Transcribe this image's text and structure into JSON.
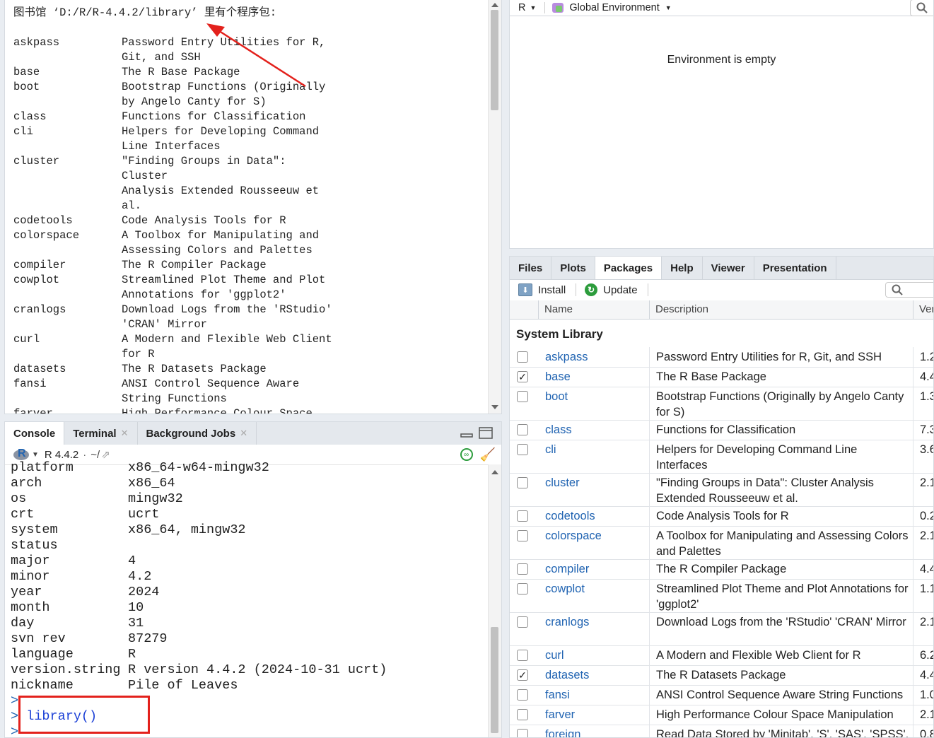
{
  "viewer": {
    "header": "图书馆 ‘D:/R/R-4.4.2/library’ 里有个程序包:",
    "libs": [
      {
        "name": "askpass",
        "desc": "Password Entry Utilities for R,\nGit, and SSH"
      },
      {
        "name": "base",
        "desc": "The R Base Package"
      },
      {
        "name": "boot",
        "desc": "Bootstrap Functions (Originally\nby Angelo Canty for S)"
      },
      {
        "name": "class",
        "desc": "Functions for Classification"
      },
      {
        "name": "cli",
        "desc": "Helpers for Developing Command\nLine Interfaces"
      },
      {
        "name": "cluster",
        "desc": "\"Finding Groups in Data\": Cluster\nAnalysis Extended Rousseeuw et\nal."
      },
      {
        "name": "codetools",
        "desc": "Code Analysis Tools for R"
      },
      {
        "name": "colorspace",
        "desc": "A Toolbox for Manipulating and\nAssessing Colors and Palettes"
      },
      {
        "name": "compiler",
        "desc": "The R Compiler Package"
      },
      {
        "name": "cowplot",
        "desc": "Streamlined Plot Theme and Plot\nAnnotations for 'ggplot2'"
      },
      {
        "name": "cranlogs",
        "desc": "Download Logs from the 'RStudio'\n'CRAN' Mirror"
      },
      {
        "name": "curl",
        "desc": "A Modern and Flexible Web Client\nfor R"
      },
      {
        "name": "datasets",
        "desc": "The R Datasets Package"
      },
      {
        "name": "fansi",
        "desc": "ANSI Control Sequence Aware\nString Functions"
      },
      {
        "name": "farver",
        "desc": "High Performance Colour Space\nManipulation"
      }
    ]
  },
  "console": {
    "tabs": [
      "Console",
      "Terminal",
      "Background Jobs"
    ],
    "version_label": "R 4.4.2",
    "path_label": "~/",
    "rows": [
      {
        "k": "platform",
        "v": "x86_64-w64-mingw32"
      },
      {
        "k": "arch",
        "v": "x86_64"
      },
      {
        "k": "os",
        "v": "mingw32"
      },
      {
        "k": "crt",
        "v": "ucrt"
      },
      {
        "k": "system",
        "v": "x86_64, mingw32"
      },
      {
        "k": "status",
        "v": ""
      },
      {
        "k": "major",
        "v": "4"
      },
      {
        "k": "minor",
        "v": "4.2"
      },
      {
        "k": "year",
        "v": "2024"
      },
      {
        "k": "month",
        "v": "10"
      },
      {
        "k": "day",
        "v": "31"
      },
      {
        "k": "svn rev",
        "v": "87279"
      },
      {
        "k": "language",
        "v": "R"
      },
      {
        "k": "version.string",
        "v": "R version 4.4.2 (2024-10-31 ucrt)"
      },
      {
        "k": "nickname",
        "v": "Pile of Leaves"
      }
    ],
    "prompt": ">",
    "command": "library()"
  },
  "env": {
    "lang": "R",
    "scope": "Global Environment",
    "empty_text": "Environment is empty"
  },
  "packages": {
    "tabs": [
      "Files",
      "Plots",
      "Packages",
      "Help",
      "Viewer",
      "Presentation"
    ],
    "install_label": "Install",
    "update_label": "Update",
    "col_name": "Name",
    "col_desc": "Description",
    "col_ver": "Ver",
    "section": "System Library",
    "rows": [
      {
        "name": "askpass",
        "desc": "Password Entry Utilities for R, Git, and SSH",
        "ver": "1.2",
        "checked": false
      },
      {
        "name": "base",
        "desc": "The R Base Package",
        "ver": "4.4",
        "checked": true
      },
      {
        "name": "boot",
        "desc": "Bootstrap Functions (Originally by Angelo Canty for S)",
        "ver": "1.3",
        "checked": false
      },
      {
        "name": "class",
        "desc": "Functions for Classification",
        "ver": "7.3",
        "checked": false
      },
      {
        "name": "cli",
        "desc": "Helpers for Developing Command Line Interfaces",
        "ver": "3.6",
        "checked": false
      },
      {
        "name": "cluster",
        "desc": "\"Finding Groups in Data\": Cluster Analysis Extended Rousseeuw et al.",
        "ver": "2.1",
        "checked": false
      },
      {
        "name": "codetools",
        "desc": "Code Analysis Tools for R",
        "ver": "0.2",
        "checked": false
      },
      {
        "name": "colorspace",
        "desc": "A Toolbox for Manipulating and Assessing Colors and Palettes",
        "ver": "2.1",
        "checked": false
      },
      {
        "name": "compiler",
        "desc": "The R Compiler Package",
        "ver": "4.4",
        "checked": false
      },
      {
        "name": "cowplot",
        "desc": "Streamlined Plot Theme and Plot Annotations for 'ggplot2'",
        "ver": "1.1",
        "checked": false
      },
      {
        "name": "cranlogs",
        "desc": "Download Logs from the 'RStudio' 'CRAN' Mirror",
        "ver": "2.1",
        "checked": false
      },
      {
        "name": "curl",
        "desc": "A Modern and Flexible Web Client for R",
        "ver": "6.2",
        "checked": false
      },
      {
        "name": "datasets",
        "desc": "The R Datasets Package",
        "ver": "4.4",
        "checked": true
      },
      {
        "name": "fansi",
        "desc": "ANSI Control Sequence Aware String Functions",
        "ver": "1.0",
        "checked": false
      },
      {
        "name": "farver",
        "desc": "High Performance Colour Space Manipulation",
        "ver": "2.1",
        "checked": false
      },
      {
        "name": "foreign",
        "desc": "Read Data Stored by 'Minitab', 'S', 'SAS', 'SPSS', 'Stata', 'Systat', 'Weka', 'dBase', ...",
        "ver": "0.8",
        "checked": false
      }
    ]
  },
  "colors": {
    "link": "#2164b2",
    "annotation": "#e3211c",
    "accent_green": "#2c9c3c"
  }
}
